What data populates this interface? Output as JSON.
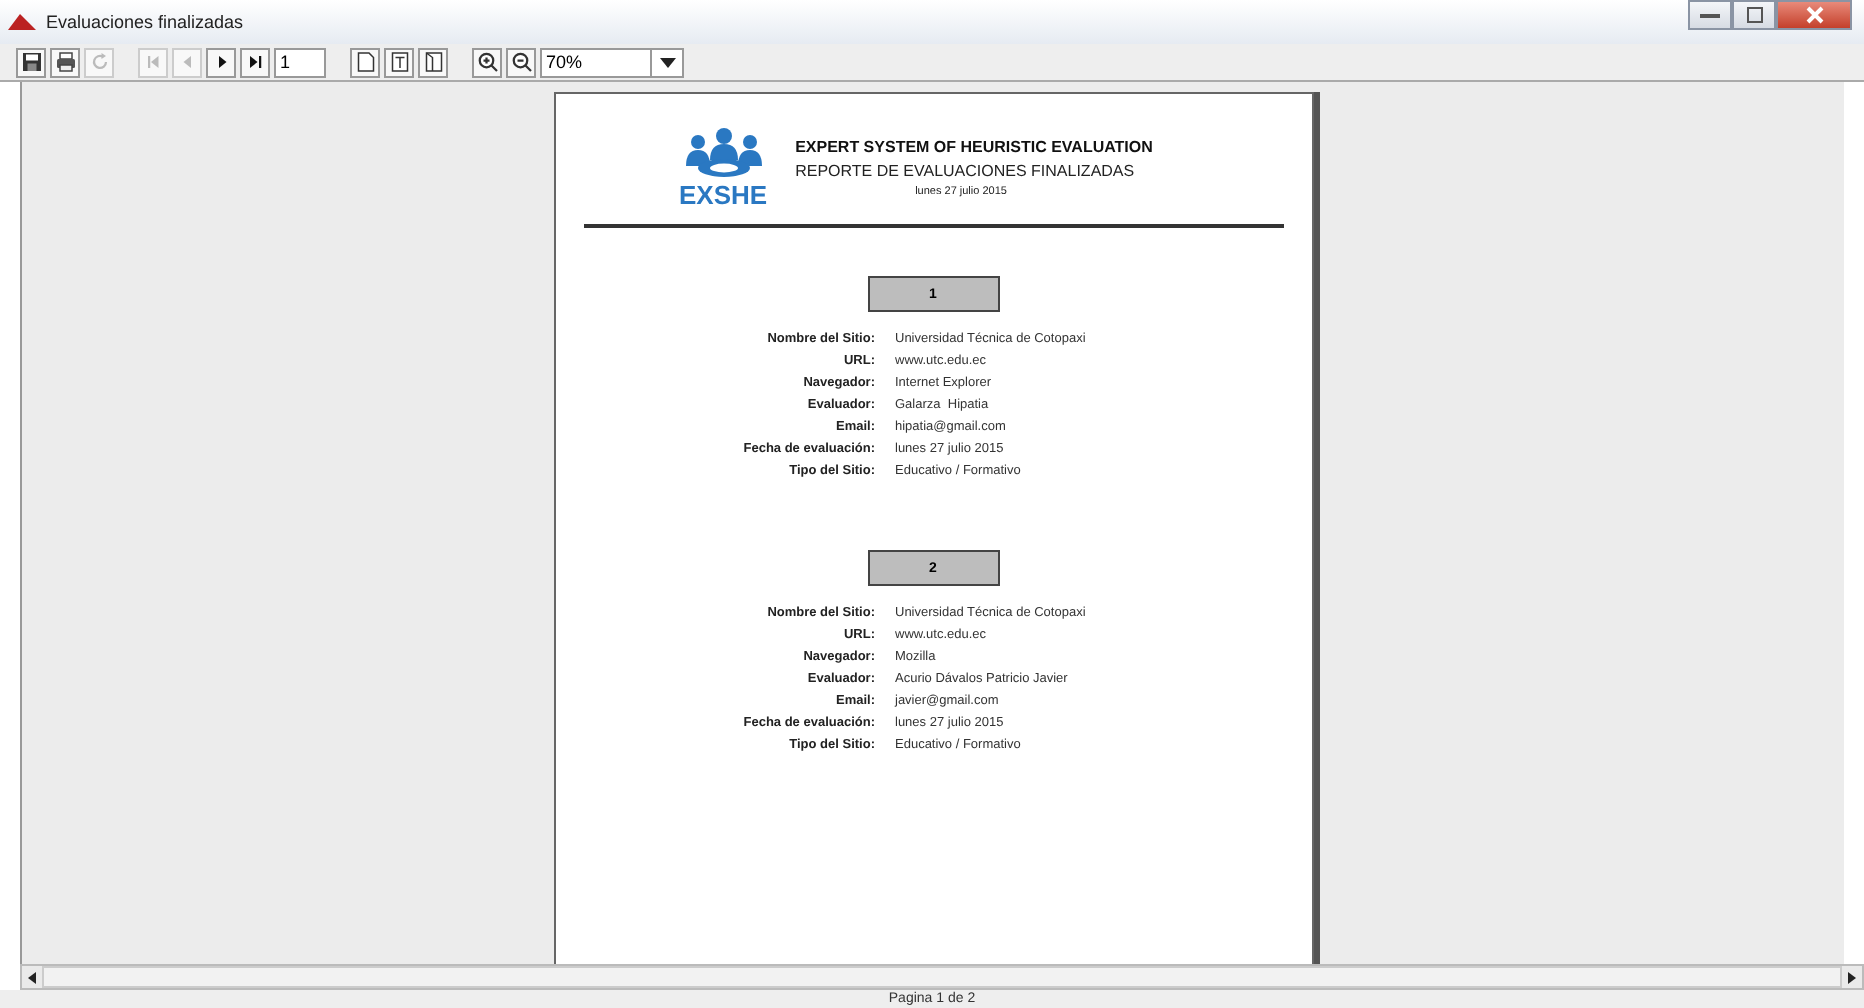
{
  "window": {
    "title": "Evaluaciones finalizadas"
  },
  "toolbar": {
    "buttons": [
      {
        "kind": "save",
        "disabled": false
      },
      {
        "kind": "print",
        "disabled": false
      },
      {
        "kind": "reload",
        "disabled": true
      },
      {
        "kind": "first",
        "disabled": true
      },
      {
        "kind": "prev",
        "disabled": true
      },
      {
        "kind": "next",
        "disabled": false
      },
      {
        "kind": "last",
        "disabled": false
      }
    ],
    "page_field": {
      "value": "1"
    },
    "view_buttons": [
      {
        "kind": "single-page",
        "disabled": false
      },
      {
        "kind": "fit-width",
        "disabled": false
      },
      {
        "kind": "fit-page",
        "disabled": false
      }
    ],
    "zoom_buttons": [
      {
        "kind": "zoom-in",
        "disabled": false
      },
      {
        "kind": "zoom-out",
        "disabled": false
      }
    ],
    "zoom_field": {
      "value": "70%"
    }
  },
  "report": {
    "logo_text": "EXSHE",
    "title": "EXPERT SYSTEM OF HEURISTIC EVALUATION",
    "subtitle": "REPORTE DE EVALUACIONES FINALIZADAS",
    "date": "lunes 27 julio 2015",
    "records": [
      {
        "number": "1",
        "fields": [
          {
            "label": "Nombre del Sitio:",
            "value": "Universidad Técnica de Cotopaxi"
          },
          {
            "label": "URL:",
            "value": "www.utc.edu.ec"
          },
          {
            "label": "Navegador:",
            "value": "Internet Explorer"
          },
          {
            "label": "Evaluador:",
            "value": "Galarza  Hipatia"
          },
          {
            "label": "Email:",
            "value": "hipatia@gmail.com"
          },
          {
            "label": "Fecha de evaluación:",
            "value": "lunes 27 julio 2015"
          },
          {
            "label": "Tipo del Sitio:",
            "value": "Educativo / Formativo"
          }
        ]
      },
      {
        "number": "2",
        "fields": [
          {
            "label": "Nombre del Sitio:",
            "value": "Universidad Técnica de Cotopaxi"
          },
          {
            "label": "URL:",
            "value": "www.utc.edu.ec"
          },
          {
            "label": "Navegador:",
            "value": "Mozilla"
          },
          {
            "label": "Evaluador:",
            "value": "Acurio Dávalos Patricio Javier"
          },
          {
            "label": "Email:",
            "value": "javier@gmail.com"
          },
          {
            "label": "Fecha de evaluación:",
            "value": "lunes 27 julio 2015"
          },
          {
            "label": "Tipo del Sitio:",
            "value": "Educativo / Formativo"
          }
        ]
      }
    ]
  },
  "status_bar": {
    "text": "Pagina 1 de 2"
  }
}
